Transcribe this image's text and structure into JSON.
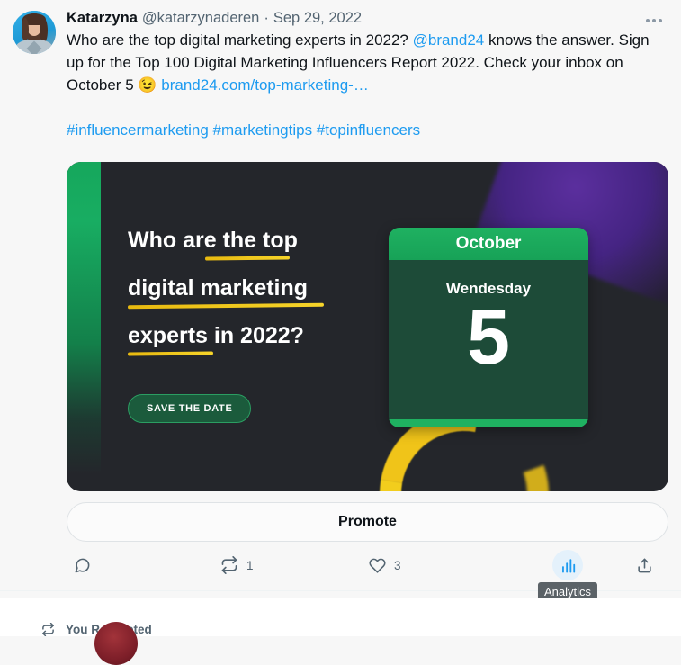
{
  "theme": {
    "page_bg": "#f7f7f7",
    "accent_blue": "#1d9bf0",
    "muted_gray": "#536471",
    "text_dark": "#0f1419",
    "card_bg": "#24262b",
    "brand_green": "#1fb161",
    "brand_yellow": "#f0c419",
    "brand_purple": "#452483",
    "tooltip_bg": "#5b6267"
  },
  "tweet": {
    "author_name": "Katarzyna",
    "author_handle": "@katarzynaderen",
    "separator": "·",
    "date": "Sep 29, 2022",
    "more_menu_label": "More",
    "text_part_1": "Who are the top digital marketing experts in 2022? ",
    "mention": "@brand24",
    "text_part_2": " knows the answer. Sign up for the Top 100 Digital Marketing Influencers Report 2022. Check your inbox on October 5 ",
    "emoji": "😉",
    "link": "brand24.com/top-marketing-…",
    "hashtags": "#influencermarketing #marketingtips #topinfluencers"
  },
  "media": {
    "alt": "Save the date promo graphic",
    "headline_line_1": "Who are the top",
    "headline_line_2": "digital marketing",
    "headline_line_3": "experts in 2022?",
    "cta_label": "SAVE THE DATE",
    "calendar": {
      "month": "October",
      "weekday": "Wendesday",
      "day": "5"
    }
  },
  "promote": {
    "label": "Promote"
  },
  "actions": {
    "reply": {
      "icon": "reply-icon",
      "count": ""
    },
    "retweet": {
      "icon": "retweet-icon",
      "count": "1"
    },
    "like": {
      "icon": "heart-icon",
      "count": "3"
    },
    "analytics": {
      "icon": "analytics-bars-icon",
      "count": "",
      "tooltip": "Analytics"
    },
    "share": {
      "icon": "share-icon",
      "count": ""
    }
  },
  "next_tweet": {
    "retweet_label": "You Retweeted"
  }
}
